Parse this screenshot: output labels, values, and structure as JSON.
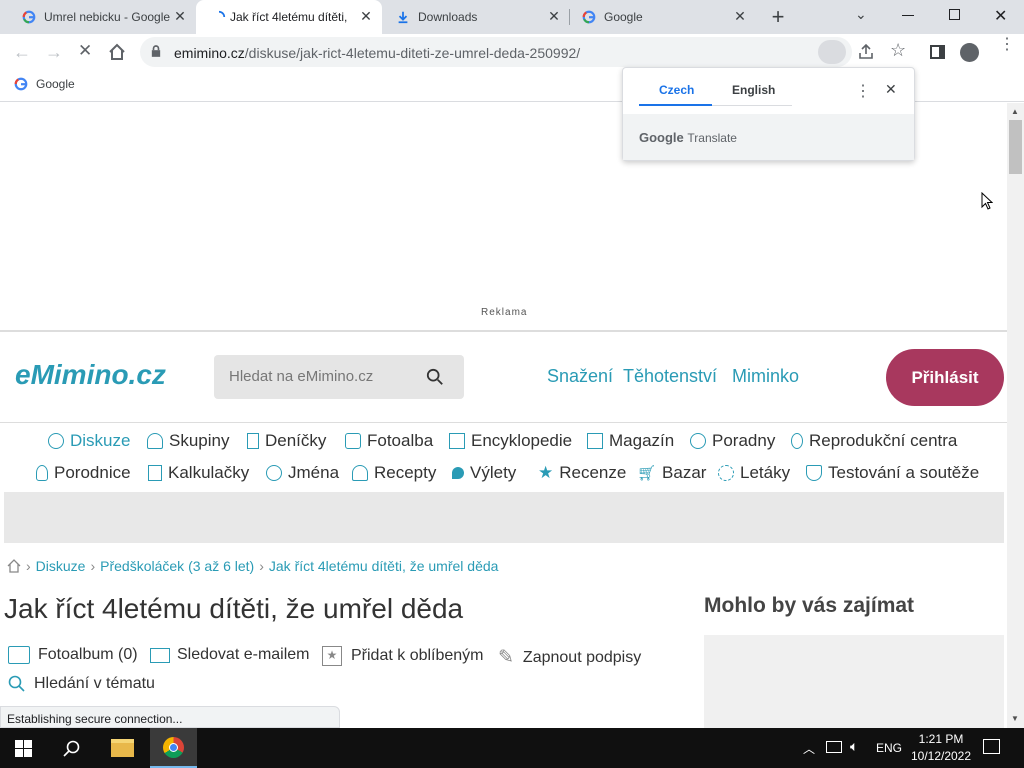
{
  "tabs": [
    {
      "title": "Umrel nebicku - Google",
      "icon": "google-g-icon"
    },
    {
      "title": "Jak říct 4letému dítěti,",
      "icon": "loading-icon"
    },
    {
      "title": "Downloads",
      "icon": "download-icon"
    },
    {
      "title": "Google",
      "icon": "google-g-icon"
    }
  ],
  "omnibox": {
    "domain": "emimino.cz",
    "path": "/diskuse/jak-rict-4letemu-diteti-ze-umrel-deda-250992/"
  },
  "bookmarks": [
    {
      "label": "Google"
    }
  ],
  "translate": {
    "lang_source": "Czech",
    "lang_target": "English",
    "brand_google": "Google",
    "brand_translate": "Translate"
  },
  "ad": {
    "label": "Reklama"
  },
  "header": {
    "logo": "eMimino.cz",
    "search_placeholder": "Hledat na eMimino.cz",
    "links": [
      "Snažení",
      "Těhotenství",
      "Miminko"
    ],
    "login": "Přihlásit"
  },
  "nav_row1": [
    "Diskuze",
    "Skupiny",
    "Deníčky",
    "Fotoalba",
    "Encyklopedie",
    "Magazín",
    "Poradny",
    "Reprodukční centra"
  ],
  "nav_row2": [
    "Porodnice",
    "Kalkulačky",
    "Jména",
    "Recepty",
    "Výlety",
    "Recenze",
    "Bazar",
    "Letáky",
    "Testování a soutěže"
  ],
  "breadcrumb": [
    "Diskuze",
    "Předškoláček (3 až 6 let)",
    "Jak říct 4letému dítěti, že umřel děda"
  ],
  "page_title": "Jak říct 4letému dítěti, že umřel děda",
  "actions": [
    "Fotoalbum (0)",
    "Sledovat e-mailem",
    "Přidat k oblíbeným",
    "Zapnout podpisy",
    "Hledání v tématu"
  ],
  "sidebar_title": "Mohlo by vás zajímat",
  "status_bar": "Establishing secure connection...",
  "taskbar": {
    "time": "1:21 PM",
    "date": "10/12/2022",
    "lang": "ENG"
  },
  "colors": {
    "brand_teal": "#2a9bb5",
    "login_btn": "#a8385e",
    "tab_strip": "#dee1e6",
    "taskbar": "#101010"
  }
}
